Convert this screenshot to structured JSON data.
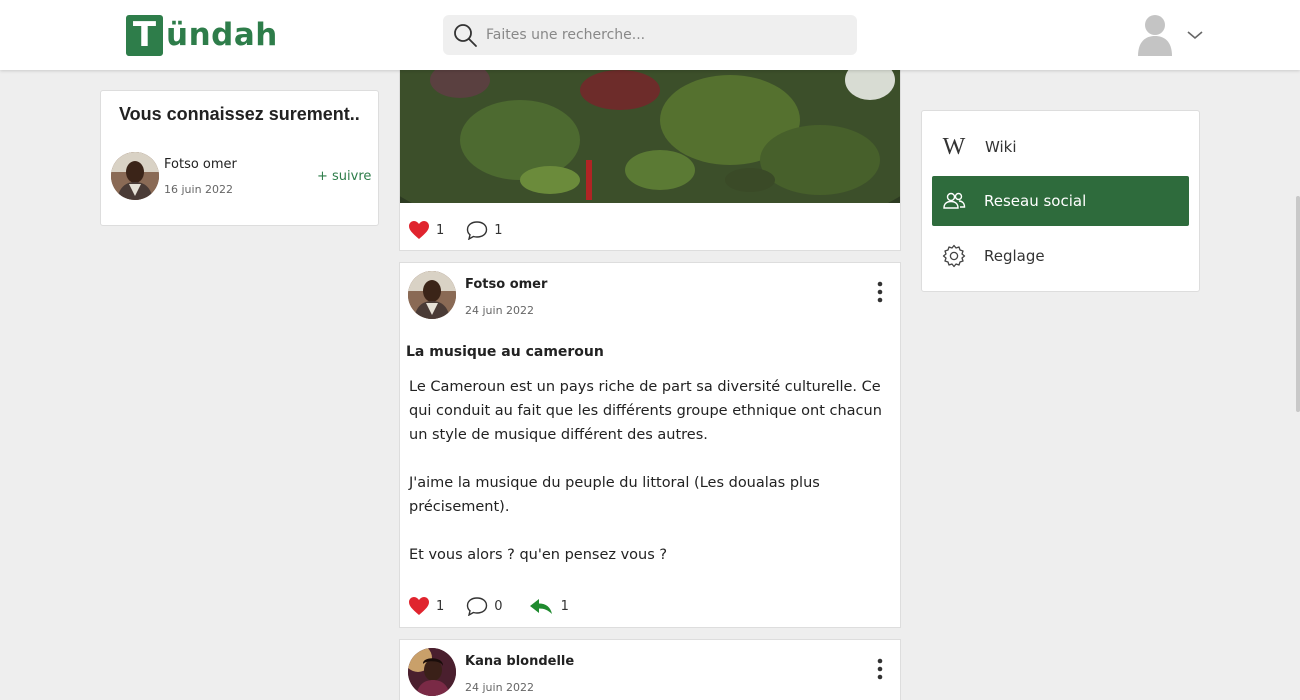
{
  "header": {
    "logo_letter": "T",
    "logo_rest": "ündah",
    "search_placeholder": "Faites une recherche...",
    "brand_color": "#2e7d4a"
  },
  "suggestions": {
    "title": "Vous connaissez surement..",
    "items": [
      {
        "name": "Fotso omer",
        "date": "16 juin 2022",
        "follow_label": "+ suivre"
      }
    ]
  },
  "feed": {
    "previous_post": {
      "likes": "1",
      "comments": "1"
    },
    "posts": [
      {
        "author": "Fotso omer",
        "date": "24 juin 2022",
        "title": "La musique au cameroun",
        "paragraphs": [
          "Le Cameroun est un pays riche de part sa diversité culturelle. Ce qui conduit au fait que les différents groupe ethnique ont chacun un style de musique différent des autres.",
          "J'aime la musique du peuple du littoral (Les doualas plus précisement).",
          "Et vous alors ? qu'en pensez vous ?"
        ],
        "likes": "1",
        "comments": "0",
        "shares": "1"
      },
      {
        "author": "Kana blondelle",
        "date": "24 juin 2022"
      }
    ]
  },
  "nav": {
    "items": [
      {
        "label": "Wiki",
        "icon": "wiki-w-icon"
      },
      {
        "label": "Reseau social",
        "icon": "users-icon",
        "active": true
      },
      {
        "label": "Reglage",
        "icon": "gear-icon"
      }
    ],
    "active_color": "#2e6b3c"
  }
}
